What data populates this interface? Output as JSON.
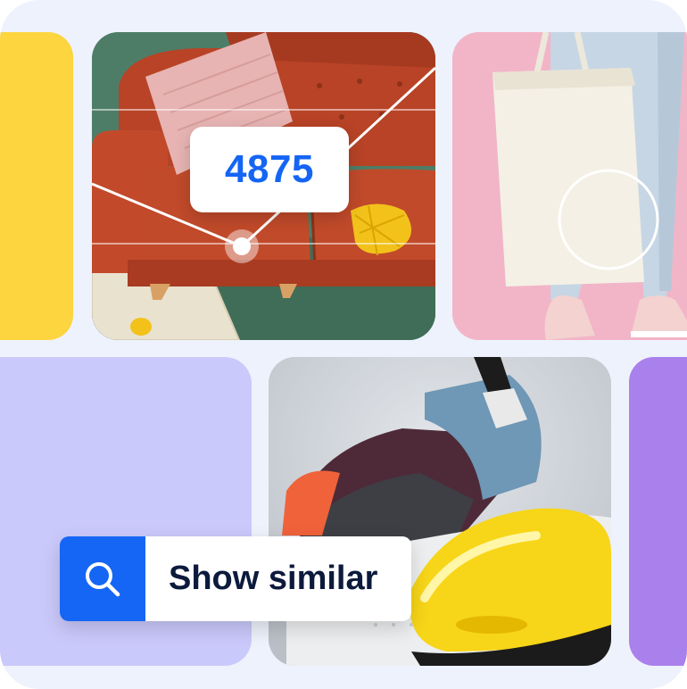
{
  "price_tag": {
    "value": "4875"
  },
  "search": {
    "label": "Show similar",
    "icon": "search-icon"
  },
  "colors": {
    "background": "#eef2fc",
    "yellow_tile": "#fcd53f",
    "lavender_tile": "#cac9fb",
    "purple_tile": "#aa80ec",
    "accent_blue": "#1565f5",
    "bag_background": "#f2b6c8"
  },
  "images": [
    "orange-sofa-photo",
    "tote-bag-photo",
    "sneaker-photo"
  ]
}
